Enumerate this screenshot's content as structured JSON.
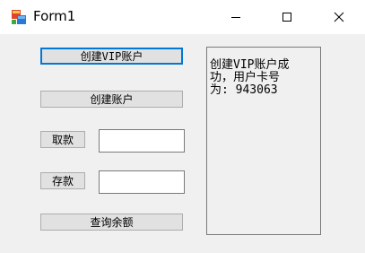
{
  "window": {
    "title": "Form1"
  },
  "buttons": {
    "create_vip": "创建VIP账户",
    "create_account": "创建账户",
    "withdraw": "取款",
    "deposit": "存款",
    "query_balance": "查询余额"
  },
  "inputs": {
    "withdraw_value": "",
    "deposit_value": ""
  },
  "output": {
    "text": "创建VIP账户成\n功，用户卡号\n为: 943063"
  },
  "icons": {
    "app": "winforms-app-icon",
    "minimize": "minimize-icon",
    "maximize": "maximize-icon",
    "close": "close-icon"
  },
  "colors": {
    "titlebar": "#ffffff",
    "client": "#f0f0f0",
    "button_face": "#e1e1e1",
    "default_button_border": "#0078d7"
  }
}
